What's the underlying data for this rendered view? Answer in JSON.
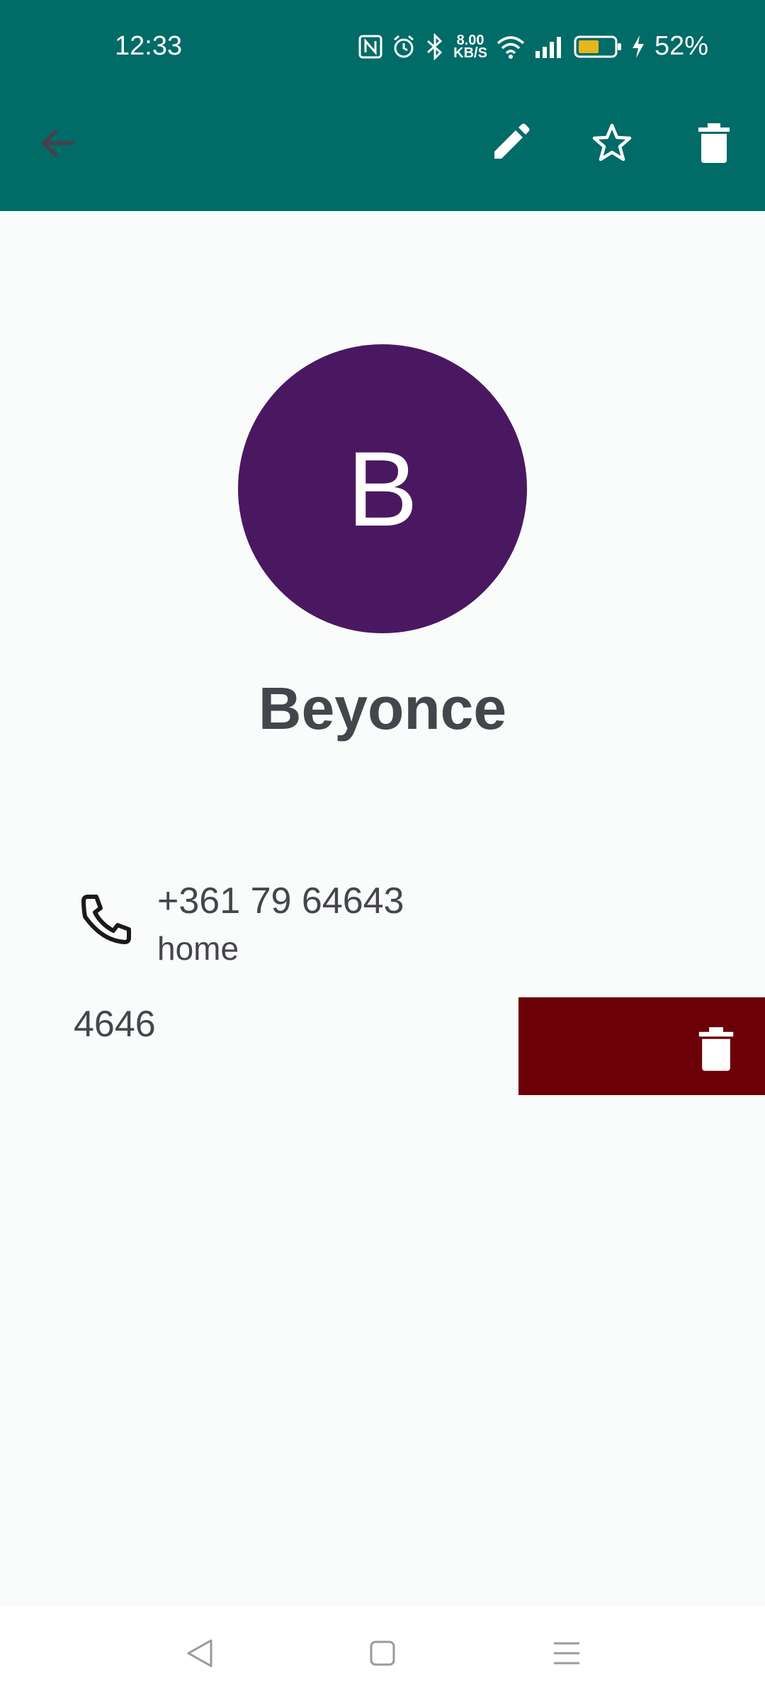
{
  "status_bar": {
    "time": "12:33",
    "net_speed_value": "8.00",
    "net_speed_unit": "KB/S",
    "battery_percent": "52%",
    "icons": [
      "nfc-icon",
      "alarm-icon",
      "bluetooth-icon",
      "wifi-icon",
      "signal-icon",
      "battery-icon",
      "charging-icon"
    ]
  },
  "app_bar": {
    "actions": [
      "back-arrow-icon",
      "edit-pencil-icon",
      "star-outline-icon",
      "delete-trash-icon"
    ]
  },
  "contact": {
    "initial": "B",
    "name": "Beyonce",
    "avatar_color": "#4a1861"
  },
  "phones": [
    {
      "number": "+361 79 64643",
      "type": "home"
    }
  ],
  "swiped_item": {
    "visible_text": "4646"
  },
  "colors": {
    "toolbar": "#006b67",
    "delete_background": "#6b0006",
    "text": "#45464c",
    "background": "#fafbfb"
  },
  "nav_bar": {
    "buttons": [
      "nav-back-icon",
      "nav-home-icon",
      "nav-recents-icon"
    ]
  }
}
